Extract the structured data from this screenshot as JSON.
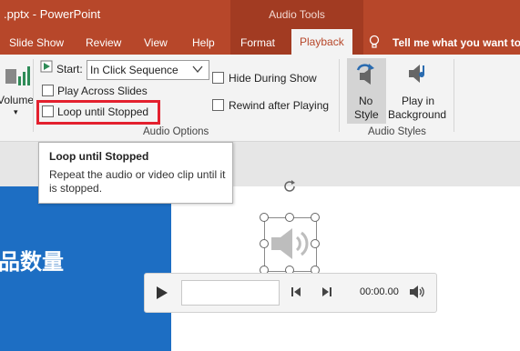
{
  "titlebar": {
    "title": ".pptx  -  PowerPoint",
    "context_tab": "Audio Tools"
  },
  "tabs": {
    "slideshow": "Slide Show",
    "review": "Review",
    "view": "View",
    "help": "Help",
    "format": "Format",
    "playback": "Playback",
    "tell_me": "Tell me what you want to d"
  },
  "ribbon": {
    "volume_label": "Volume",
    "start_label": "Start:",
    "start_value": "In Click Sequence",
    "play_across_slides": "Play Across Slides",
    "loop_until_stopped": "Loop until Stopped",
    "hide_during_show": "Hide During Show",
    "rewind_after_playing": "Rewind after Playing",
    "audio_options_group": "Audio Options",
    "no_style_line1": "No",
    "no_style_line2": "Style",
    "play_bg_line1": "Play in",
    "play_bg_line2": "Background",
    "audio_styles_group": "Audio Styles"
  },
  "tooltip": {
    "title": "Loop until Stopped",
    "description": "Repeat the audio or video clip until it is stopped."
  },
  "slide": {
    "text": "品数量"
  },
  "player": {
    "time": "00:00.00"
  },
  "colors": {
    "brand": "#b7472a",
    "highlight": "#e3202e",
    "slide_blue": "#1d6ec3"
  }
}
